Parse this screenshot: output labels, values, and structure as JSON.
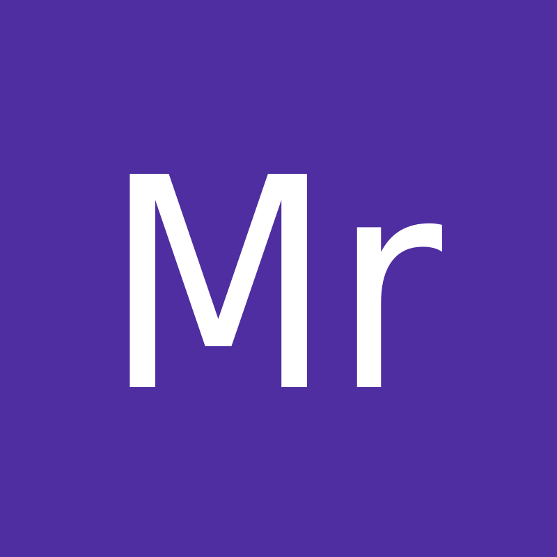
{
  "avatar": {
    "initials": "Mr",
    "background_color": "#4e2ea1",
    "text_color": "#ffffff"
  }
}
